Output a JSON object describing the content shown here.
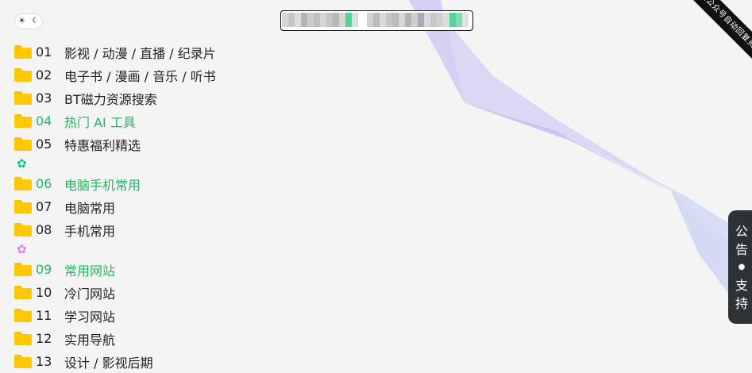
{
  "theme_toggle": {
    "light_icon": "sun-icon",
    "dark_icon": "moon-icon"
  },
  "search": {
    "value": "",
    "placeholder": ""
  },
  "corner_ribbon": {
    "text": "获取公众号自动回复资源"
  },
  "side_tab": {
    "line1a": "公",
    "line1b": "告",
    "separator": "●",
    "line2a": "支",
    "line2b": "持"
  },
  "colors": {
    "accent_green": "#23b860",
    "folder_yellow": "#ffc800",
    "gear_green": "#12c97a",
    "gear_pink": "#e37ee6"
  },
  "categories": [
    {
      "num": "01",
      "label": "影视 / 动漫 / 直播 / 纪录片"
    },
    {
      "num": "02",
      "label": "电子书 / 漫画 / 音乐 / 听书"
    },
    {
      "num": "03",
      "label": "BT磁力资源搜索"
    },
    {
      "num": "04",
      "label": "热门 AI 工具"
    },
    {
      "num": "05",
      "label": "特惠福利精选"
    },
    {
      "num": "06",
      "label": "电脑手机常用"
    },
    {
      "num": "07",
      "label": "电脑常用"
    },
    {
      "num": "08",
      "label": "手机常用"
    },
    {
      "num": "09",
      "label": "常用网站"
    },
    {
      "num": "10",
      "label": "冷门网站"
    },
    {
      "num": "11",
      "label": "学习网站"
    },
    {
      "num": "12",
      "label": "实用导航"
    },
    {
      "num": "13",
      "label": "设计 / 影视后期"
    }
  ]
}
